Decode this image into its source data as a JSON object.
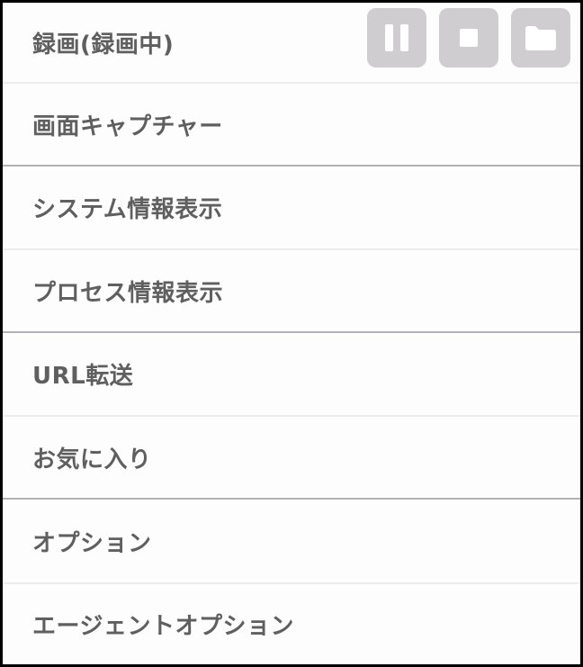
{
  "menu": {
    "items": [
      {
        "label": "録画(録画中)"
      },
      {
        "label": "画面キャプチャー"
      },
      {
        "label": "システム情報表示"
      },
      {
        "label": "プロセス情報表示"
      },
      {
        "label": "URL転送"
      },
      {
        "label": "お気に入り"
      },
      {
        "label": "オプション"
      },
      {
        "label": "エージェントオプション"
      }
    ],
    "recording_controls": {
      "pause_icon": "pause-icon",
      "stop_icon": "stop-icon",
      "folder_icon": "folder-icon"
    }
  },
  "colors": {
    "text": "#5f5f5f",
    "button_bg": "#cfcdcf",
    "icon_fill": "#ffffff",
    "border": "#000000"
  }
}
